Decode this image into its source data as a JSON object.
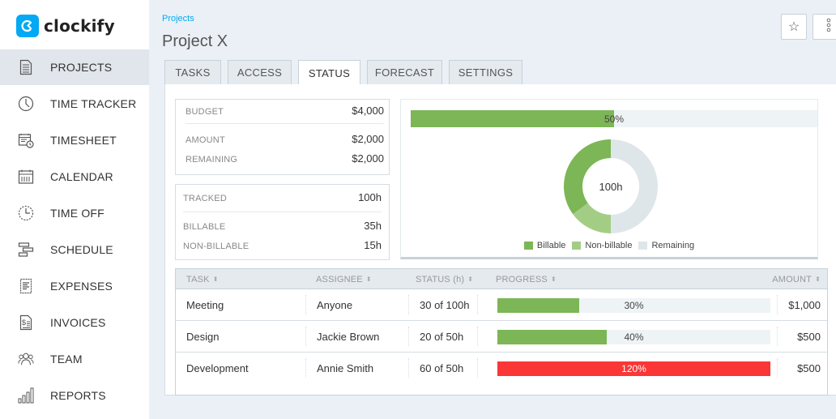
{
  "app": {
    "name": "clockify",
    "brand_color": "#03a9f4"
  },
  "sidebar": {
    "items": [
      {
        "label": "PROJECTS",
        "icon": "document-icon",
        "active": true
      },
      {
        "label": "TIME TRACKER",
        "icon": "clock-icon",
        "active": false
      },
      {
        "label": "TIMESHEET",
        "icon": "timesheet-icon",
        "active": false
      },
      {
        "label": "CALENDAR",
        "icon": "calendar-icon",
        "active": false
      },
      {
        "label": "TIME OFF",
        "icon": "time-off-icon",
        "active": false
      },
      {
        "label": "SCHEDULE",
        "icon": "schedule-icon",
        "active": false
      },
      {
        "label": "EXPENSES",
        "icon": "receipt-icon",
        "active": false
      },
      {
        "label": "INVOICES",
        "icon": "invoice-icon",
        "active": false
      },
      {
        "label": "TEAM",
        "icon": "team-icon",
        "active": false
      },
      {
        "label": "REPORTS",
        "icon": "bar-chart-icon",
        "active": false
      }
    ]
  },
  "header": {
    "breadcrumb": "Projects",
    "title": "Project X",
    "favorite_icon": "☆",
    "more_icon": "⋮"
  },
  "tabs": [
    {
      "label": "TASKS",
      "active": false
    },
    {
      "label": "ACCESS",
      "active": false
    },
    {
      "label": "STATUS",
      "active": true
    },
    {
      "label": "FORECAST",
      "active": false
    },
    {
      "label": "SETTINGS",
      "active": false
    }
  ],
  "budget_card": {
    "budget_label": "BUDGET",
    "budget_value": "$4,000",
    "amount_label": "AMOUNT",
    "amount_value": "$2,000",
    "remaining_label": "REMAINING",
    "remaining_value": "$2,000"
  },
  "time_card": {
    "tracked_label": "TRACKED",
    "tracked_value": "100h",
    "billable_label": "BILLABLE",
    "billable_value": "35h",
    "nonbillable_label": "NON-BILLABLE",
    "nonbillable_value": "15h"
  },
  "budget_progress": {
    "percent": 50,
    "label": "50%",
    "color": "#7cb656"
  },
  "chart_data": {
    "type": "pie",
    "subtype": "donut",
    "center_label": "100h",
    "slices": [
      {
        "name": "Billable",
        "value": 35,
        "color": "#7cb656"
      },
      {
        "name": "Non-billable",
        "value": 15,
        "color": "#a3cd85"
      },
      {
        "name": "Remaining",
        "value": 50,
        "color": "#dfe6ea"
      }
    ],
    "legend": [
      "Billable",
      "Non-billable",
      "Remaining"
    ],
    "legend_position": "bottom"
  },
  "table": {
    "columns": [
      "TASK",
      "ASSIGNEE",
      "STATUS (h)",
      "PROGRESS",
      "AMOUNT"
    ],
    "sort_icon": "⬍",
    "rows": [
      {
        "task": "Meeting",
        "assignee": "Anyone",
        "status": "30 of 100h",
        "progress": 30,
        "progress_label": "30%",
        "amount": "$1,000",
        "over": false
      },
      {
        "task": "Design",
        "assignee": "Jackie Brown",
        "status": "20 of 50h",
        "progress": 40,
        "progress_label": "40%",
        "amount": "$500",
        "over": false
      },
      {
        "task": "Development",
        "assignee": "Annie Smith",
        "status": "60 of 50h",
        "progress": 120,
        "progress_label": "120%",
        "amount": "$500",
        "over": true
      }
    ],
    "ok_color": "#7cb656",
    "over_color": "#fb3636"
  }
}
